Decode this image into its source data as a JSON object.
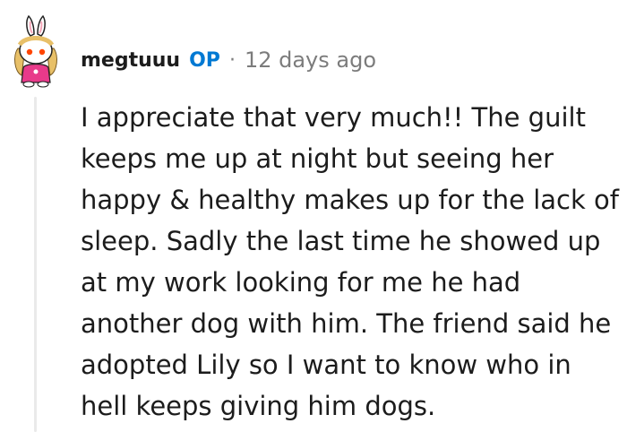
{
  "comment": {
    "username": "megtuuu",
    "op_badge": "OP",
    "separator": "·",
    "timestamp": "12 days ago",
    "body_lines": [
      "I appreciate that very much!! The guilt",
      "keeps me up at night but seeing her",
      "happy & healthy makes up for the lack of",
      "sleep. Sadly the last time he showed up",
      "at my work looking for me he had",
      "another dog with him. The friend said he",
      "adopted Lily so I want to know who in",
      "hell keeps giving him dogs."
    ],
    "avatar_icon": "snoo-avatar-icon"
  },
  "colors": {
    "username": "#1c1c1c",
    "op_badge": "#0079d3",
    "meta": "#7c7c7c",
    "thread_line": "#eaeaea"
  }
}
